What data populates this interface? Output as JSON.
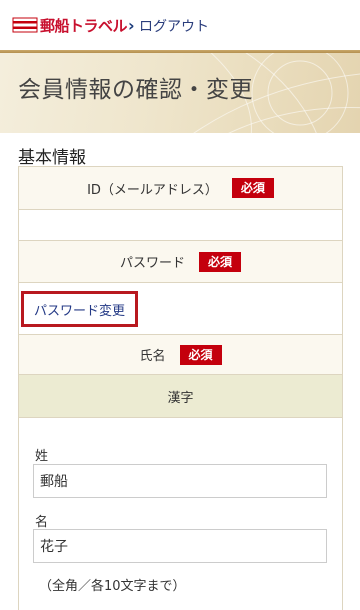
{
  "header": {
    "logo_text": "郵船トラベル",
    "logout_label": "ログアウト"
  },
  "banner": {
    "title": "会員情報の確認・変更"
  },
  "section": {
    "title": "基本情報"
  },
  "form": {
    "id_label": "ID（メールアドレス）",
    "required_badge": "必須",
    "id_value": "",
    "password_label": "パスワード",
    "password_change_link": "パスワード変更",
    "name_label": "氏名",
    "kanji_label": "漢字",
    "last_name_label": "姓",
    "last_name_value": "郵船",
    "first_name_label": "名",
    "first_name_value": "花子",
    "name_note": "（全角／各10文字まで）"
  },
  "colors": {
    "brand_red": "#c4000d",
    "link_blue": "#243a86",
    "gold_rule": "#c9a86b"
  }
}
